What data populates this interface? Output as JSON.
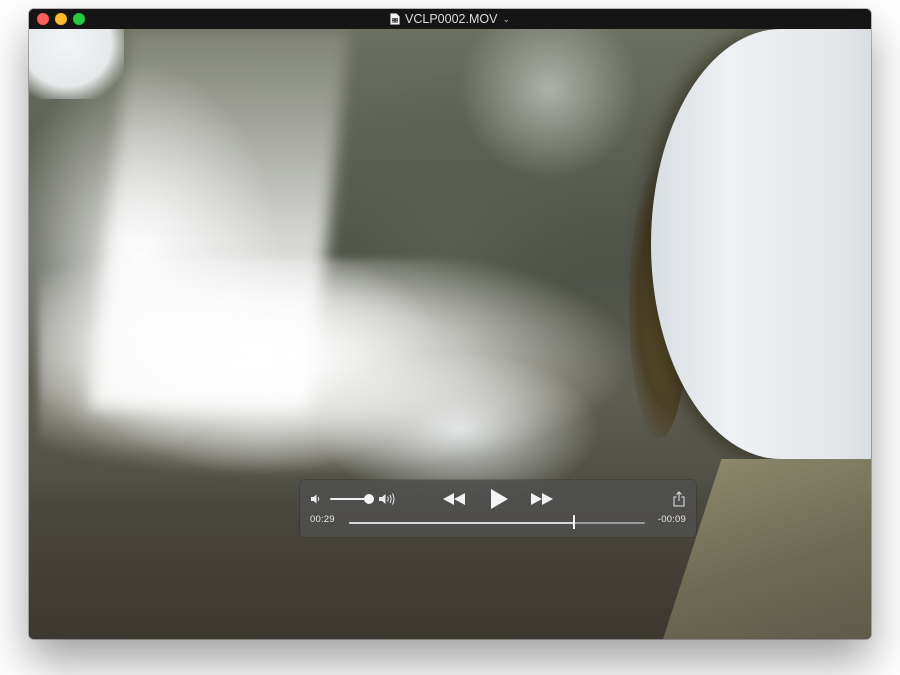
{
  "window": {
    "title": "VCLP0002.MOV",
    "title_icon": "movie-document-icon",
    "traffic_lights": {
      "close_color": "#fc5f57",
      "minimize_color": "#fdbc2e",
      "maximize_color": "#28c840"
    }
  },
  "player": {
    "current_time": "00:29",
    "remaining_time": "-00:09",
    "progress_fraction": 0.76,
    "volume_fraction": 0.85,
    "icons": {
      "volume_low": "volume-low-icon",
      "volume_high": "volume-high-icon",
      "rewind": "rewind-icon",
      "play": "play-icon",
      "fast_forward": "fast-forward-icon",
      "share": "share-icon"
    }
  }
}
